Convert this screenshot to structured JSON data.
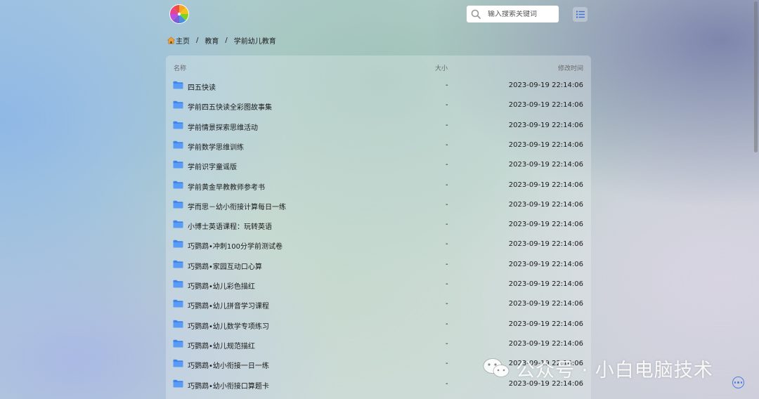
{
  "search": {
    "placeholder": "输入搜索关键词"
  },
  "breadcrumb": {
    "items": [
      "主页",
      "教育",
      "学前幼儿教育"
    ],
    "separator": "/"
  },
  "table": {
    "headers": {
      "name": "名称",
      "size": "大小",
      "modified": "修改时间"
    },
    "rows": [
      {
        "name": "四五快读",
        "size": "-",
        "modified": "2023-09-19 22:14:06"
      },
      {
        "name": "学前四五快读全彩图故事集",
        "size": "-",
        "modified": "2023-09-19 22:14:06"
      },
      {
        "name": "学前情景探索思维活动",
        "size": "-",
        "modified": "2023-09-19 22:14:06"
      },
      {
        "name": "学前数学思维训练",
        "size": "-",
        "modified": "2023-09-19 22:14:06"
      },
      {
        "name": "学前识字童谣版",
        "size": "-",
        "modified": "2023-09-19 22:14:06"
      },
      {
        "name": "学前黄金早教教师参考书",
        "size": "-",
        "modified": "2023-09-19 22:14:06"
      },
      {
        "name": "学而思－幼小衔接计算每日一练",
        "size": "-",
        "modified": "2023-09-19 22:14:06"
      },
      {
        "name": "小博士英语课程：玩转英语",
        "size": "-",
        "modified": "2023-09-19 22:14:06"
      },
      {
        "name": "巧鹦鹉•冲刺100分学前测试卷",
        "size": "-",
        "modified": "2023-09-19 22:14:06"
      },
      {
        "name": "巧鹦鹉•家园互动口心算",
        "size": "-",
        "modified": "2023-09-19 22:14:06"
      },
      {
        "name": "巧鹦鹉•幼儿彩色描红",
        "size": "-",
        "modified": "2023-09-19 22:14:06"
      },
      {
        "name": "巧鹦鹉•幼儿拼音学习课程",
        "size": "-",
        "modified": "2023-09-19 22:14:06"
      },
      {
        "name": "巧鹦鹉•幼儿数学专项练习",
        "size": "-",
        "modified": "2023-09-19 22:14:06"
      },
      {
        "name": "巧鹦鹉•幼儿规范描红",
        "size": "-",
        "modified": "2023-09-19 22:14:06"
      },
      {
        "name": "巧鹦鹉•幼小衔接一日一练",
        "size": "-",
        "modified": "2023-09-19 22:14:06"
      },
      {
        "name": "巧鹦鹉•幼小衔接口算题卡",
        "size": "-",
        "modified": "2023-09-19 22:14:06"
      }
    ]
  },
  "watermark": {
    "text": "公众号 · 小白电脑技术"
  },
  "icons": {
    "logo": "color-wheel-logo",
    "search": "search-icon",
    "view": "list-view-icon",
    "home": "home-icon",
    "folder": "folder-icon",
    "more": "more-icon",
    "watermark": "wechat-icon"
  },
  "colors": {
    "folder": "#4a8ef0",
    "accent": "#4b7fe0"
  }
}
